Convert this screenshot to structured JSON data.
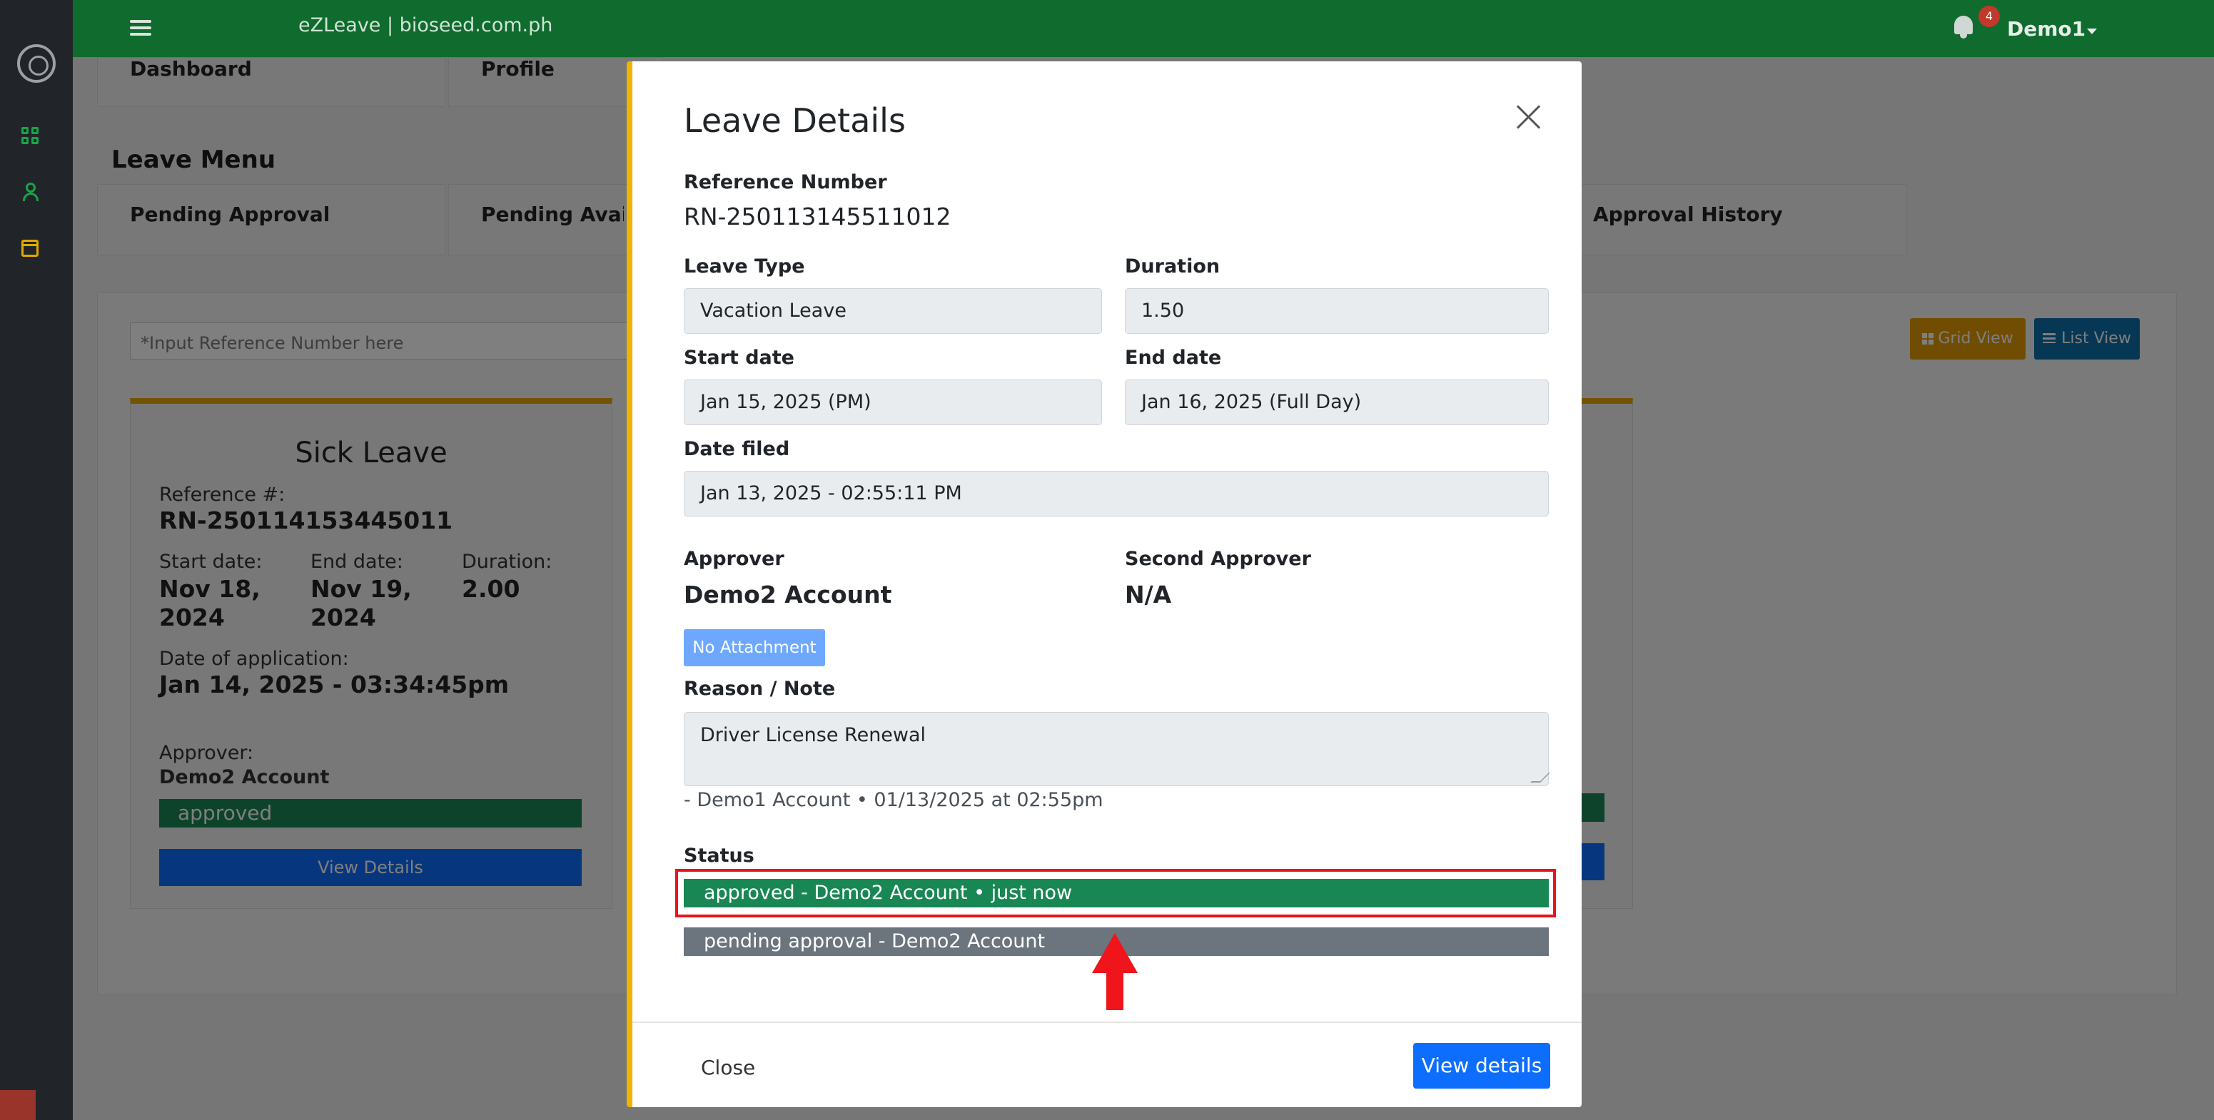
{
  "topbar": {
    "brand": "eZLeave | bioseed.com.ph",
    "notification_count": "4",
    "user": "Demo1"
  },
  "nav_cards": {
    "dashboard": "Dashboard",
    "profile": "Profile"
  },
  "leave_menu": {
    "title": "Leave Menu",
    "items": [
      "Pending Approval",
      "Pending Availment",
      "Approval History"
    ]
  },
  "search": {
    "placeholder": "*Input Reference Number here"
  },
  "view_toggle": {
    "grid": "Grid View",
    "list": "List View"
  },
  "leave_card": {
    "title": "Sick Leave",
    "ref_label": "Reference #:",
    "ref": "RN-250114153445011",
    "start_label": "Start date:",
    "start_1": "Nov 18,",
    "start_2": "2024",
    "end_label": "End date:",
    "end_1": "Nov 19,",
    "end_2": "2024",
    "duration_label": "Duration:",
    "duration": "2.00",
    "date_app_label": "Date of application:",
    "date_app": "Jan 14, 2025 - 03:34:45pm",
    "approver_label": "Approver:",
    "approver": "Demo2 Account",
    "status": "approved",
    "view_button": "View Details"
  },
  "modal": {
    "title": "Leave Details",
    "ref_label": "Reference Number",
    "ref": "RN-250113145511012",
    "leave_type_label": "Leave Type",
    "leave_type": "Vacation Leave",
    "duration_label": "Duration",
    "duration": "1.50",
    "start_label": "Start date",
    "start": "Jan 15, 2025 (PM)",
    "end_label": "End date",
    "end": "Jan 16, 2025 (Full Day)",
    "filed_label": "Date filed",
    "filed": "Jan 13, 2025 - 02:55:11 PM",
    "approver_label": "Approver",
    "approver": "Demo2 Account",
    "second_approver_label": "Second Approver",
    "second_approver": "N/A",
    "attachment": "No Attachment",
    "reason_label": "Reason / Note",
    "reason": "Driver License Renewal",
    "note": "- Demo1 Account • 01/13/2025 at 02:55pm",
    "status_label": "Status",
    "status_approved": "approved - Demo2 Account • just now",
    "status_pending": "pending approval - Demo2 Account",
    "close_button": "Close",
    "view_details_button": "View details"
  }
}
